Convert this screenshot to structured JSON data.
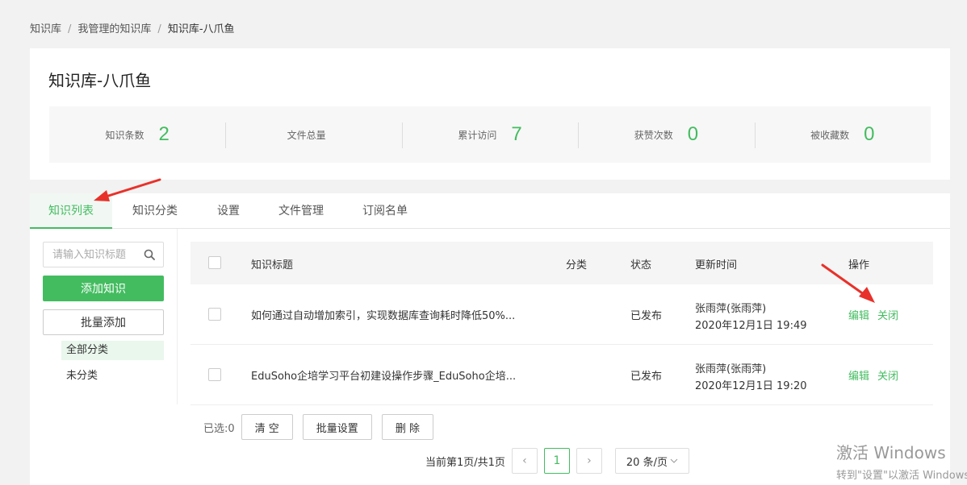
{
  "breadcrumb": {
    "items": [
      "知识库",
      "我管理的知识库",
      "知识库-八爪鱼"
    ],
    "separator": "/"
  },
  "page": {
    "title": "知识库-八爪鱼"
  },
  "stats": [
    {
      "label": "知识条数",
      "value": "2"
    },
    {
      "label": "文件总量",
      "value": ""
    },
    {
      "label": "累计访问",
      "value": "7"
    },
    {
      "label": "获赞次数",
      "value": "0"
    },
    {
      "label": "被收藏数",
      "value": "0"
    }
  ],
  "tabs": [
    {
      "label": "知识列表",
      "active": true
    },
    {
      "label": "知识分类",
      "active": false
    },
    {
      "label": "设置",
      "active": false
    },
    {
      "label": "文件管理",
      "active": false
    },
    {
      "label": "订阅名单",
      "active": false
    }
  ],
  "sidebar": {
    "search_placeholder": "请输入知识标题",
    "search_value": "",
    "add_label": "添加知识",
    "batch_add_label": "批量添加",
    "categories": [
      {
        "label": "全部分类",
        "active": true
      },
      {
        "label": "未分类",
        "active": false
      }
    ]
  },
  "table": {
    "headers": {
      "title": "知识标题",
      "category": "分类",
      "status": "状态",
      "updated": "更新时间",
      "actions": "操作"
    },
    "rows": [
      {
        "title": "如何通过自动增加索引，实现数据库查询耗时降低50%...",
        "category": "",
        "status": "已发布",
        "author": "张雨萍(张雨萍)",
        "time": "2020年12月1日 19:49",
        "edit": "编辑",
        "close": "关闭"
      },
      {
        "title": "EduSoho企培学习平台初建设操作步骤_EduSoho企培...",
        "category": "",
        "status": "已发布",
        "author": "张雨萍(张雨萍)",
        "time": "2020年12月1日 19:20",
        "edit": "编辑",
        "close": "关闭"
      }
    ]
  },
  "footer": {
    "selected_label": "已选:0",
    "clear_label": "清 空",
    "batch_set_label": "批量设置",
    "delete_label": "删 除"
  },
  "pagination": {
    "summary": "当前第1页/共1页",
    "prev_icon": "chevron-left-icon",
    "current_page": "1",
    "next_icon": "chevron-right-icon",
    "per_page": "20 条/页"
  },
  "watermark": {
    "line1": "激活 Windows",
    "line2": "转到\"设置\"以激活 Windows"
  },
  "colors": {
    "accent": "#43bc60",
    "annotation_arrow": "#e8312a"
  }
}
